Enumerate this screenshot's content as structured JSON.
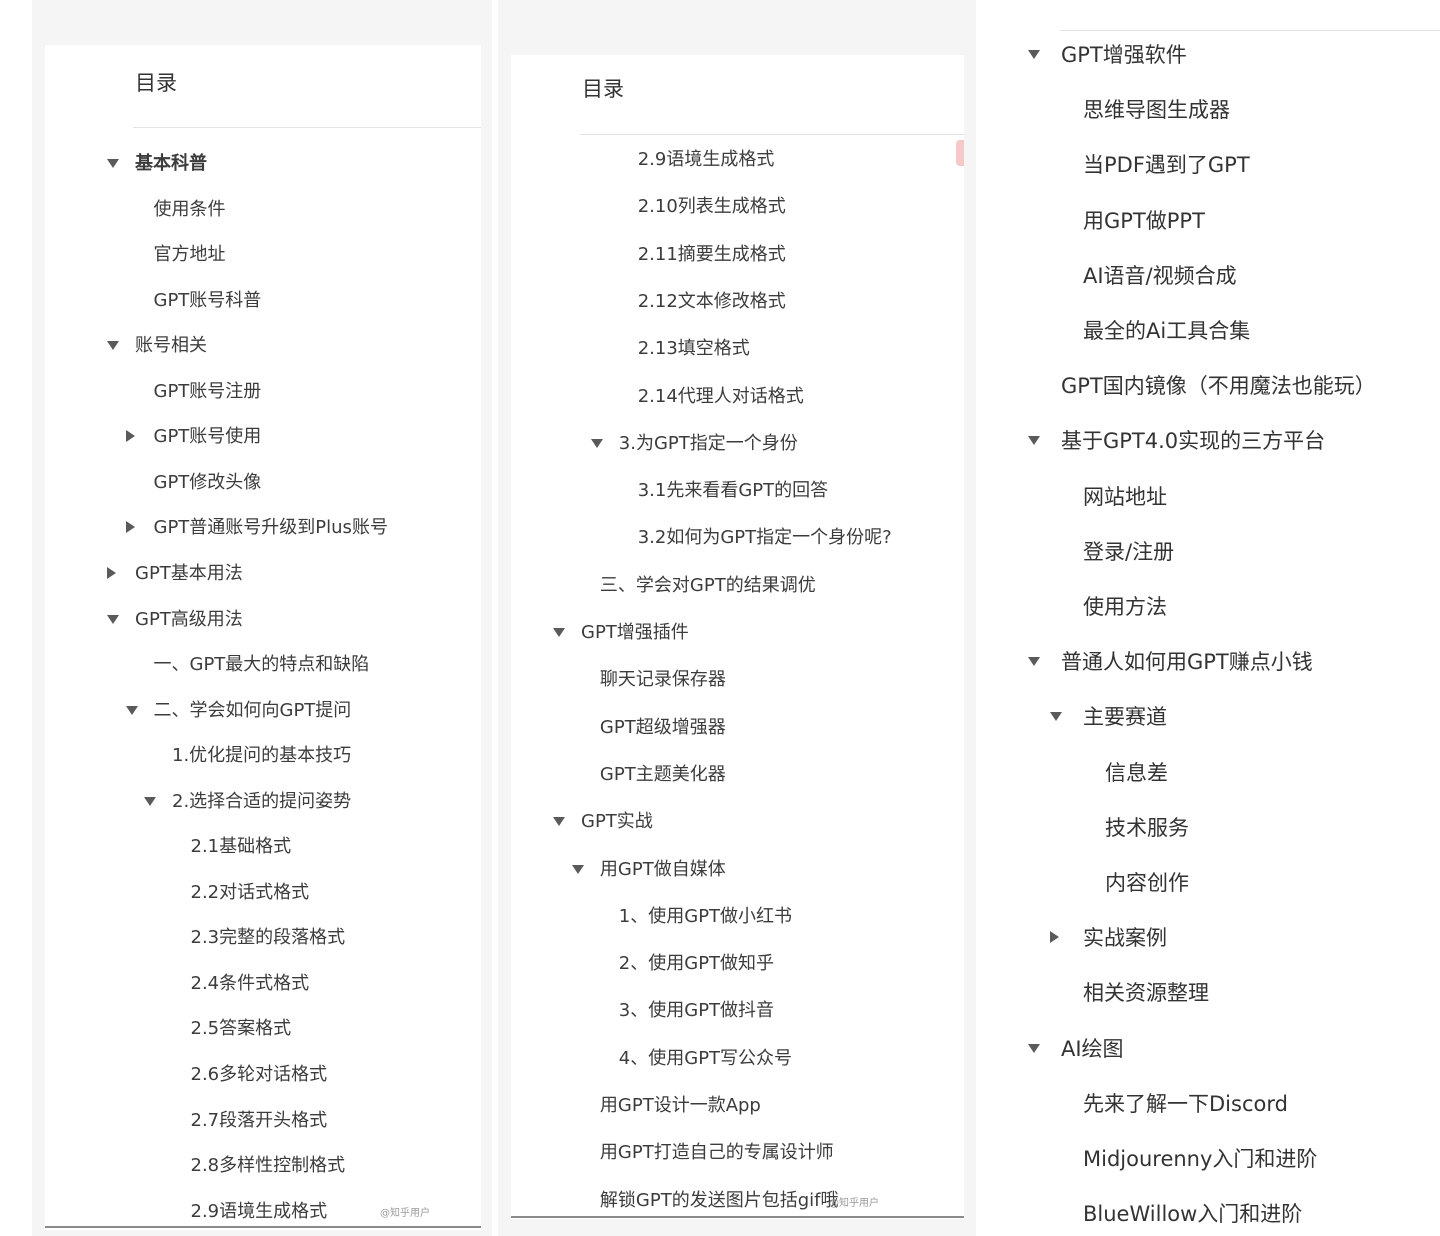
{
  "panel1": {
    "title": "目录",
    "watermark": "@知乎用户",
    "items": [
      {
        "label": "基本科普",
        "level": 0,
        "toggle": "expanded",
        "active": true
      },
      {
        "label": "使用条件",
        "level": 1,
        "toggle": "none"
      },
      {
        "label": "官方地址",
        "level": 1,
        "toggle": "none"
      },
      {
        "label": "GPT账号科普",
        "level": 1,
        "toggle": "none"
      },
      {
        "label": "账号相关",
        "level": 0,
        "toggle": "expanded"
      },
      {
        "label": "GPT账号注册",
        "level": 1,
        "toggle": "none"
      },
      {
        "label": "GPT账号使用",
        "level": 1,
        "toggle": "collapsed"
      },
      {
        "label": "GPT修改头像",
        "level": 1,
        "toggle": "none"
      },
      {
        "label": "GPT普通账号升级到Plus账号",
        "level": 1,
        "toggle": "collapsed"
      },
      {
        "label": "GPT基本用法",
        "level": 0,
        "toggle": "collapsed"
      },
      {
        "label": "GPT高级用法",
        "level": 0,
        "toggle": "expanded"
      },
      {
        "label": "一、GPT最大的特点和缺陷",
        "level": 1,
        "toggle": "none"
      },
      {
        "label": "二、学会如何向GPT提问",
        "level": 1,
        "toggle": "expanded"
      },
      {
        "label": "1.优化提问的基本技巧",
        "level": 2,
        "toggle": "none"
      },
      {
        "label": "2.选择合适的提问姿势",
        "level": 2,
        "toggle": "expanded"
      },
      {
        "label": "2.1基础格式",
        "level": 3,
        "toggle": "none"
      },
      {
        "label": "2.2对话式格式",
        "level": 3,
        "toggle": "none"
      },
      {
        "label": "2.3完整的段落格式",
        "level": 3,
        "toggle": "none"
      },
      {
        "label": "2.4条件式格式",
        "level": 3,
        "toggle": "none"
      },
      {
        "label": "2.5答案格式",
        "level": 3,
        "toggle": "none"
      },
      {
        "label": "2.6多轮对话格式",
        "level": 3,
        "toggle": "none"
      },
      {
        "label": "2.7段落开头格式",
        "level": 3,
        "toggle": "none"
      },
      {
        "label": "2.8多样性控制格式",
        "level": 3,
        "toggle": "none"
      },
      {
        "label": "2.9语境生成格式",
        "level": 3,
        "toggle": "none"
      }
    ]
  },
  "panel2": {
    "title": "目录",
    "watermark": "@知乎用户",
    "items": [
      {
        "label": "2.9语境生成格式",
        "level": 3,
        "toggle": "none"
      },
      {
        "label": "2.10列表生成格式",
        "level": 3,
        "toggle": "none"
      },
      {
        "label": "2.11摘要生成格式",
        "level": 3,
        "toggle": "none"
      },
      {
        "label": "2.12文本修改格式",
        "level": 3,
        "toggle": "none"
      },
      {
        "label": "2.13填空格式",
        "level": 3,
        "toggle": "none"
      },
      {
        "label": "2.14代理人对话格式",
        "level": 3,
        "toggle": "none"
      },
      {
        "label": "3.为GPT指定一个身份",
        "level": 2,
        "toggle": "expanded"
      },
      {
        "label": "3.1先来看看GPT的回答",
        "level": 3,
        "toggle": "none"
      },
      {
        "label": "3.2如何为GPT指定一个身份呢?",
        "level": 3,
        "toggle": "none"
      },
      {
        "label": "三、学会对GPT的结果调优",
        "level": 1,
        "toggle": "none"
      },
      {
        "label": "GPT增强插件",
        "level": 0,
        "toggle": "expanded"
      },
      {
        "label": "聊天记录保存器",
        "level": 1,
        "toggle": "none"
      },
      {
        "label": "GPT超级增强器",
        "level": 1,
        "toggle": "none"
      },
      {
        "label": "GPT主题美化器",
        "level": 1,
        "toggle": "none"
      },
      {
        "label": "GPT实战",
        "level": 0,
        "toggle": "expanded"
      },
      {
        "label": "用GPT做自媒体",
        "level": 1,
        "toggle": "expanded"
      },
      {
        "label": "1、使用GPT做小红书",
        "level": 2,
        "toggle": "none"
      },
      {
        "label": "2、使用GPT做知乎",
        "level": 2,
        "toggle": "none"
      },
      {
        "label": "3、使用GPT做抖音",
        "level": 2,
        "toggle": "none"
      },
      {
        "label": "4、使用GPT写公众号",
        "level": 2,
        "toggle": "none"
      },
      {
        "label": "用GPT设计一款App",
        "level": 1,
        "toggle": "none"
      },
      {
        "label": "用GPT打造自己的专属设计师",
        "level": 1,
        "toggle": "none"
      },
      {
        "label": "解锁GPT的发送图片包括gif哦",
        "level": 1,
        "toggle": "none"
      }
    ]
  },
  "panel3": {
    "items": [
      {
        "label": "GPT增强软件",
        "level": 0,
        "toggle": "expanded"
      },
      {
        "label": "思维导图生成器",
        "level": 1,
        "toggle": "none"
      },
      {
        "label": "当PDF遇到了GPT",
        "level": 1,
        "toggle": "none"
      },
      {
        "label": "用GPT做PPT",
        "level": 1,
        "toggle": "none"
      },
      {
        "label": "AI语音/视频合成",
        "level": 1,
        "toggle": "none"
      },
      {
        "label": "最全的Ai工具合集",
        "level": 1,
        "toggle": "none"
      },
      {
        "label": "GPT国内镜像（不用魔法也能玩）",
        "level": 0,
        "toggle": "none"
      },
      {
        "label": "基于GPT4.0实现的三方平台",
        "level": 0,
        "toggle": "expanded"
      },
      {
        "label": "网站地址",
        "level": 1,
        "toggle": "none"
      },
      {
        "label": "登录/注册",
        "level": 1,
        "toggle": "none"
      },
      {
        "label": "使用方法",
        "level": 1,
        "toggle": "none"
      },
      {
        "label": "普通人如何用GPT赚点小钱",
        "level": 0,
        "toggle": "expanded"
      },
      {
        "label": "主要赛道",
        "level": 1,
        "toggle": "expanded"
      },
      {
        "label": "信息差",
        "level": 2,
        "toggle": "none"
      },
      {
        "label": "技术服务",
        "level": 2,
        "toggle": "none"
      },
      {
        "label": "内容创作",
        "level": 2,
        "toggle": "none"
      },
      {
        "label": "实战案例",
        "level": 1,
        "toggle": "collapsed"
      },
      {
        "label": "相关资源整理",
        "level": 1,
        "toggle": "none"
      },
      {
        "label": "AI绘图",
        "level": 0,
        "toggle": "expanded"
      },
      {
        "label": "先来了解一下Discord",
        "level": 1,
        "toggle": "none"
      },
      {
        "label": "Midjourenny入门和进阶",
        "level": 1,
        "toggle": "none"
      },
      {
        "label": "BlueWillow入门和进阶",
        "level": 1,
        "toggle": "none"
      }
    ]
  },
  "colors": {
    "active": "#2f6fd6",
    "text": "#3c3c3c",
    "arrow": "#5a5a5a",
    "background": "#f5f5f5"
  }
}
